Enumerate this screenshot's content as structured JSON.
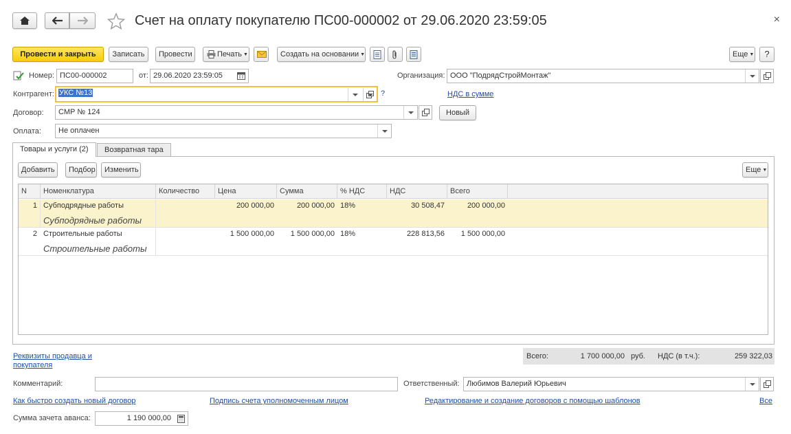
{
  "title": "Счет на оплату покупателю ПС00-000002 от 29.06.2020 23:59:05",
  "toolbar": {
    "post_close": "Провести и закрыть",
    "save": "Записать",
    "post": "Провести",
    "print": "Печать",
    "create_based": "Создать на основании",
    "more": "Еще",
    "help": "?"
  },
  "form": {
    "number_label": "Номер:",
    "number_value": "ПС00-000002",
    "from_label": "от:",
    "date_value": "29.06.2020 23:59:05",
    "org_label": "Организация:",
    "org_value": "ООО \"ПодрядСтройМонтаж\"",
    "contractor_label": "Контрагент:",
    "contractor_value": "УКС №13",
    "contractor_help": "?",
    "vat_link": "НДС в сумме",
    "contract_label": "Договор:",
    "contract_value": "СМР № 124",
    "new_button": "Новый",
    "payment_label": "Оплата:",
    "payment_value": "Не оплачен"
  },
  "tabs": [
    "Товары и услуги (2)",
    "Возвратная тара"
  ],
  "table_toolbar": {
    "add": "Добавить",
    "select": "Подбор",
    "edit": "Изменить",
    "more": "Еще"
  },
  "table": {
    "columns": [
      "N",
      "Номенклатура",
      "Количество",
      "Цена",
      "Сумма",
      "% НДС",
      "НДС",
      "Всего"
    ],
    "rows": [
      {
        "n": "1",
        "item": "Субподрядные работы",
        "content": "Субподрядные работы",
        "qty": "",
        "price": "200 000,00",
        "sum": "200 000,00",
        "vat_rate": "18%",
        "vat": "30 508,47",
        "total": "200 000,00"
      },
      {
        "n": "2",
        "item": "Строительные работы",
        "content": "Строительные работы",
        "qty": "",
        "price": "1 500 000,00",
        "sum": "1 500 000,00",
        "vat_rate": "18%",
        "vat": "228 813,56",
        "total": "1 500 000,00"
      }
    ]
  },
  "totals": {
    "total_label": "Всего:",
    "total_value": "1 700 000,00",
    "currency": "руб.",
    "vat_label": "НДС (в т.ч.):",
    "vat_value": "259 322,03"
  },
  "footer": {
    "requisites_link_1": "Реквизиты продавца и",
    "requisites_link_2": "покупателя",
    "comment_label": "Комментарий:",
    "comment_value": "",
    "responsible_label": "Ответственный:",
    "responsible_value": "Любимов Валерий Юрьевич",
    "link_new_contract": "Как быстро создать новый договор",
    "link_signature": "Подпись счета уполномоченным лицом",
    "link_templates": "Редактирование и создание договоров с помощью шаблонов",
    "link_all": "Все",
    "advance_label": "Сумма зачета аванса:",
    "advance_value": "1 190 000,00"
  },
  "colors": {
    "primary_button": "#f7cd0b",
    "link": "#1c4fa8",
    "selected_row": "#fbf3cc",
    "focus_border": "#f0c23e"
  }
}
